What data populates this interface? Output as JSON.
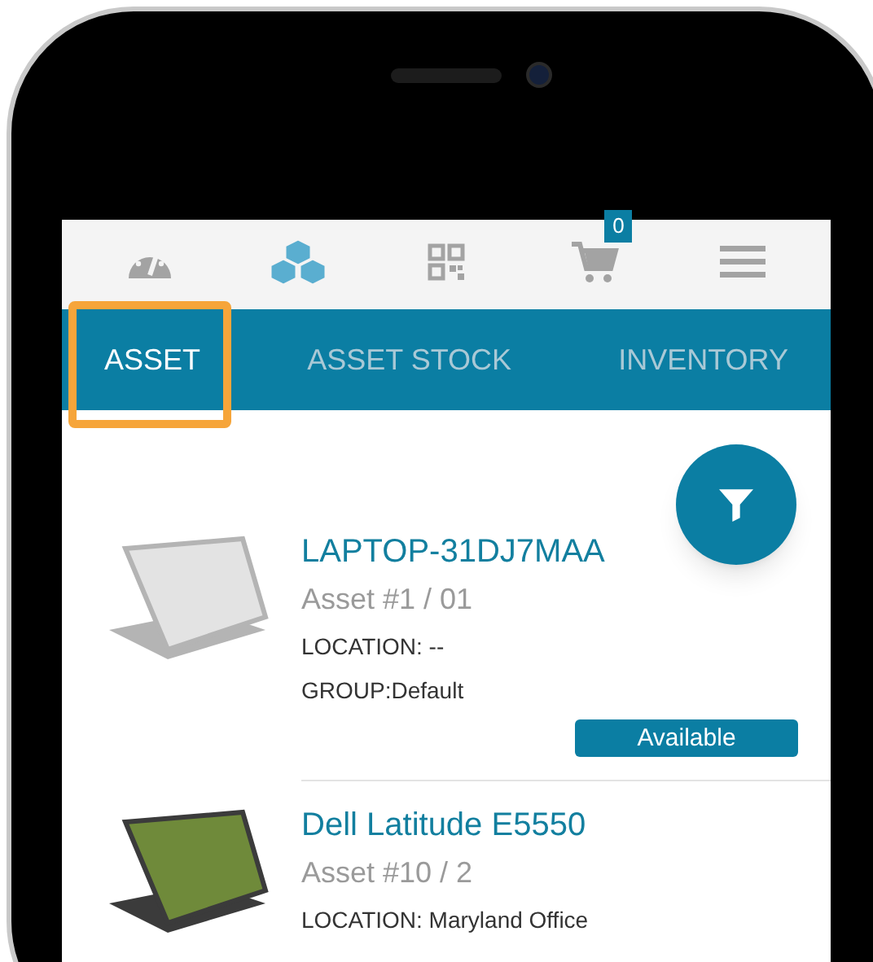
{
  "nav_icons": [
    {
      "kind": "gauge",
      "selected": false
    },
    {
      "kind": "cubes",
      "selected": true
    },
    {
      "kind": "qr",
      "selected": false
    },
    {
      "kind": "cart",
      "selected": false,
      "badge": "0"
    },
    {
      "kind": "menu",
      "selected": false
    }
  ],
  "tabs": [
    {
      "label": "ASSET",
      "selected": true
    },
    {
      "label": "ASSET STOCK",
      "selected": false
    },
    {
      "label": "INVENTORY",
      "selected": false
    }
  ],
  "assets": [
    {
      "title": "LAPTOP-31DJ7MAA",
      "subtitle": "Asset #1 / 01",
      "location": "LOCATION: --",
      "group": "GROUP:Default",
      "status": "Available"
    },
    {
      "title": "Dell Latitude E5550",
      "subtitle": "Asset #10 / 2",
      "location": "LOCATION: Maryland Office"
    }
  ]
}
